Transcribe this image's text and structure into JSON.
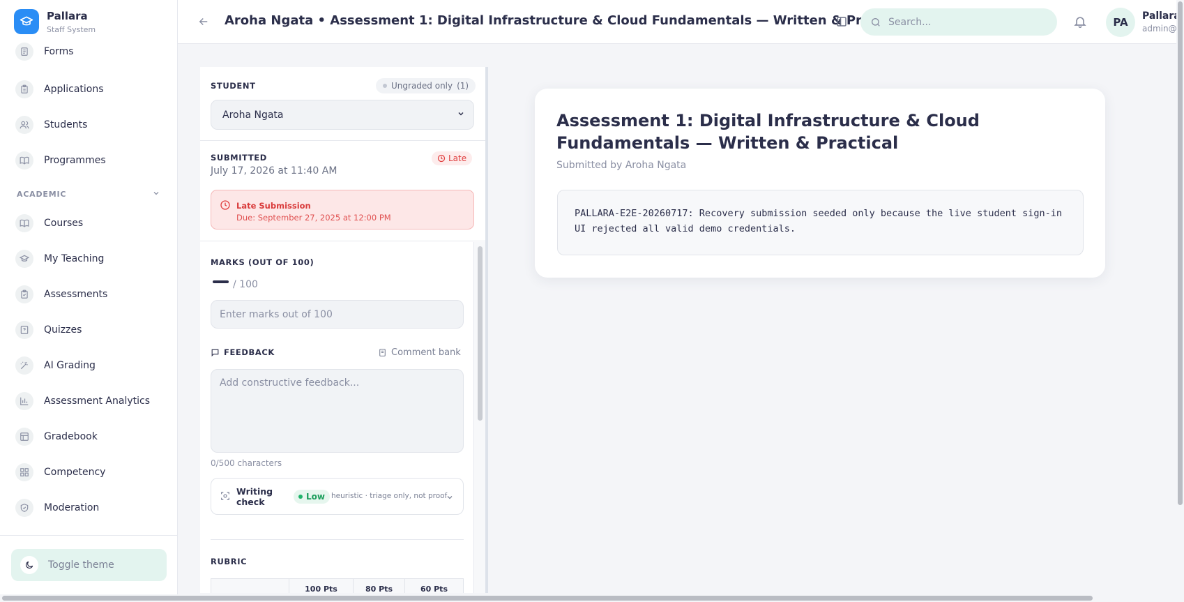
{
  "brand": {
    "name": "Pallara",
    "subtitle": "Staff System"
  },
  "sidebar": {
    "items_top": [
      {
        "label": "Forms",
        "icon": "form-icon"
      },
      {
        "label": "Applications",
        "icon": "clipboard-icon"
      },
      {
        "label": "Students",
        "icon": "users-icon"
      },
      {
        "label": "Programmes",
        "icon": "book-icon"
      }
    ],
    "section_academic": "ACADEMIC",
    "items_academic": [
      {
        "label": "Courses",
        "icon": "book-icon"
      },
      {
        "label": "My Teaching",
        "icon": "graduation-cap-icon"
      },
      {
        "label": "Assessments",
        "icon": "clipboard-check-icon"
      },
      {
        "label": "Quizzes",
        "icon": "question-icon"
      },
      {
        "label": "AI Grading",
        "icon": "wand-icon"
      },
      {
        "label": "Assessment Analytics",
        "icon": "bar-chart-icon"
      },
      {
        "label": "Gradebook",
        "icon": "table-icon"
      },
      {
        "label": "Competency",
        "icon": "grid-icon"
      },
      {
        "label": "Moderation",
        "icon": "shield-check-icon"
      }
    ],
    "toggle_theme": "Toggle theme"
  },
  "header": {
    "title": "Aroha Ngata • Assessment 1: Digital Infrastructure & Cloud Fundamentals — Written & Practical",
    "search_placeholder": "Search...",
    "avatar_initials": "PA",
    "user_name": "Pallara",
    "user_email": "admin@"
  },
  "grading": {
    "student_label": "STUDENT",
    "ungraded_label": "Ungraded only",
    "ungraded_count": "(1)",
    "student_selected": "Aroha Ngata",
    "submitted_label": "SUBMITTED",
    "submitted_date": "July 17, 2026 at 11:40 AM",
    "late_badge": "Late",
    "late_title": "Late Submission",
    "late_due": "Due: September 27, 2025 at 12:00 PM",
    "marks_label": "MARKS (OUT OF 100)",
    "marks_of": "/ 100",
    "marks_placeholder": "Enter marks out of 100",
    "feedback_label": "FEEDBACK",
    "comment_bank": "Comment bank",
    "feedback_placeholder": "Add constructive feedback...",
    "char_count": "0/500 characters",
    "writing_check_label": "Writing check",
    "writing_check_level": "Low",
    "writing_check_note": "heuristic · triage only, not proof",
    "rubric_label": "RUBRIC",
    "rubric_columns": [
      "",
      "100 Pts",
      "80 Pts",
      "60 Pts"
    ]
  },
  "submission": {
    "title": "Assessment 1: Digital Infrastructure & Cloud Fundamentals — Written & Practical",
    "submitted_by": "Submitted by Aroha Ngata",
    "content": "PALLARA-E2E-20260717: Recovery submission seeded only because the live student sign-in UI rejected all valid demo credentials."
  },
  "colors": {
    "accent": "#2a8df5",
    "mint": "#e3f4ef",
    "late_red": "#e04040",
    "low_green": "#1b9e5c"
  }
}
